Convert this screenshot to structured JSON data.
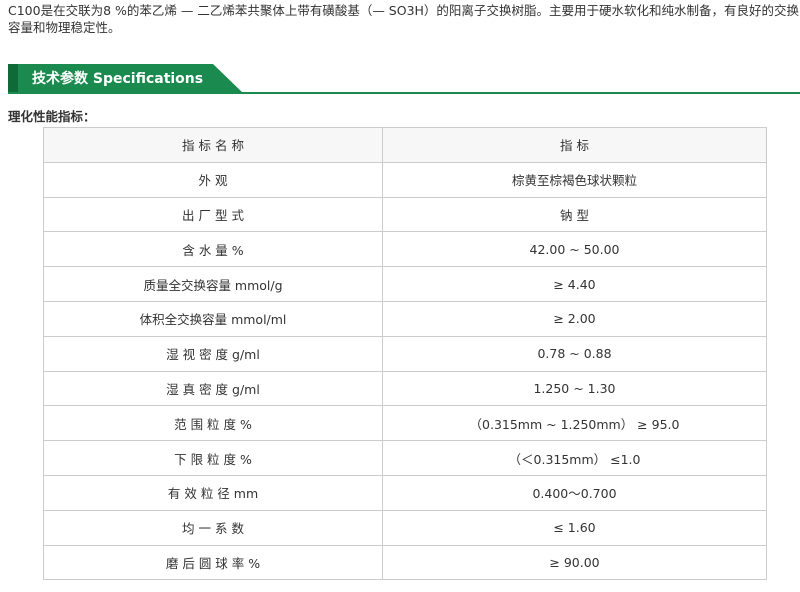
{
  "intro": {
    "text": "C100是在交联为8 %的苯乙烯 — 二乙烯苯共聚体上带有磺酸基（— SO3H）的阳离子交换树脂。主要用于硬水软化和纯水制备，有良好的交换容量和物理稳定性。"
  },
  "header": {
    "title": "技术参数  Specifications"
  },
  "section": {
    "label": "理化性能指标："
  },
  "table": {
    "columns": [
      "指 标 名 称",
      "指 标"
    ],
    "rows": [
      [
        "外 观",
        "棕黄至棕褐色球状颗粒"
      ],
      [
        "出 厂 型 式",
        "钠 型"
      ],
      [
        "含 水 量 %",
        "42.00 ~ 50.00"
      ],
      [
        "质量全交换容量 mmol/g",
        "≥ 4.40"
      ],
      [
        "体积全交换容量 mmol/ml",
        "≥ 2.00"
      ],
      [
        "湿 视 密 度 g/ml",
        "0.78 ~ 0.88"
      ],
      [
        "湿 真 密 度 g/ml",
        "1.250 ~ 1.30"
      ],
      [
        "范 围 粒 度 %",
        "（0.315mm ~ 1.250mm） ≥ 95.0"
      ],
      [
        "下 限 粒 度 %",
        "（＜0.315mm） ≤1.0"
      ],
      [
        "有 效 粒 径 mm",
        "0.400～0.700"
      ],
      [
        "均 一 系 数",
        "≤ 1.60"
      ],
      [
        "磨 后 圆 球 率 %",
        "≥ 90.00"
      ]
    ]
  },
  "colors": {
    "accent": "#1a8a4e",
    "accent_dark": "#0e6b38",
    "border": "#cccccc",
    "text": "#333333"
  }
}
